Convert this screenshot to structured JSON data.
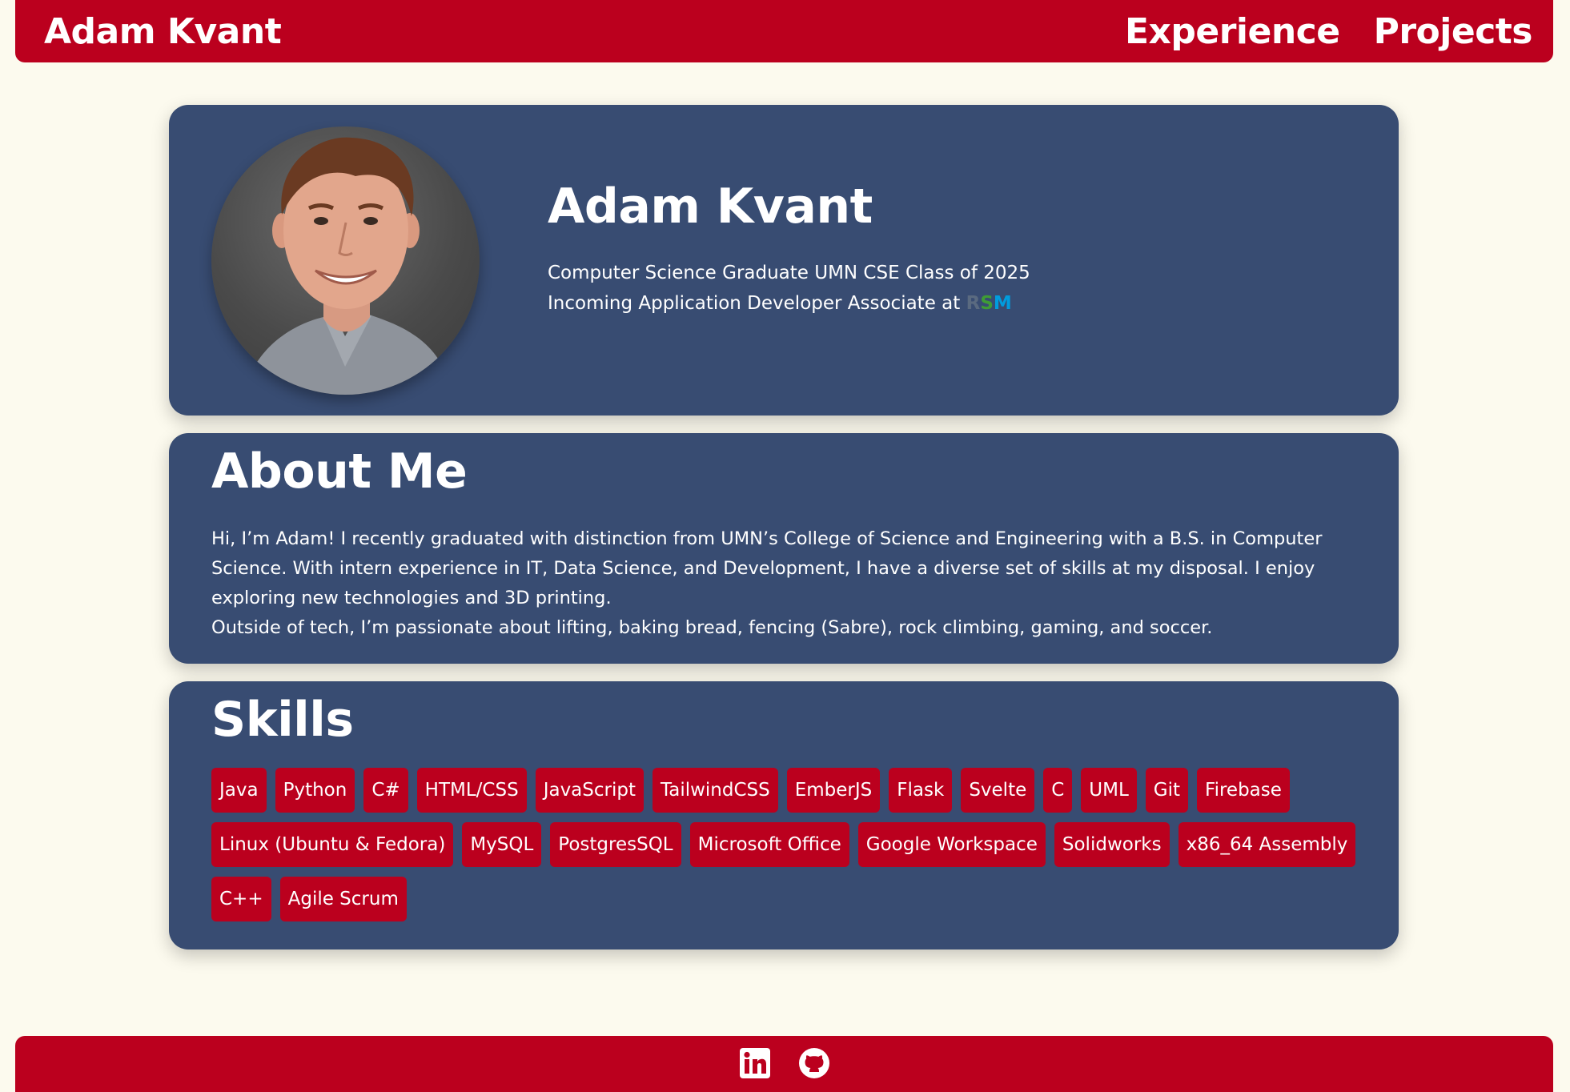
{
  "header": {
    "brand": "Adam Kvant",
    "nav": [
      {
        "label": "Experience"
      },
      {
        "label": "Projects"
      }
    ]
  },
  "hero": {
    "name": "Adam Kvant",
    "line1": "Computer Science Graduate UMN CSE Class of 2025",
    "line2_prefix": "Incoming Application Developer Associate at ",
    "company_logo": {
      "r": "R",
      "s": "S",
      "m": "M"
    }
  },
  "about": {
    "title": "About Me",
    "paragraph1": "Hi, I’m Adam! I recently graduated with distinction from UMN’s College of Science and Engineering with a B.S. in Computer Science. With intern experience in IT, Data Science, and Development, I have a diverse set of skills at my disposal. I enjoy exploring new technologies and 3D printing.",
    "paragraph2": "Outside of tech, I’m passionate about lifting, baking bread, fencing (Sabre), rock climbing, gaming, and soccer."
  },
  "skills": {
    "title": "Skills",
    "tags": [
      "Java",
      "Python",
      "C#",
      "HTML/CSS",
      "JavaScript",
      "TailwindCSS",
      "EmberJS",
      "Flask",
      "Svelte",
      "C",
      "UML",
      "Git",
      "Firebase",
      "Linux (Ubuntu & Fedora)",
      "MySQL",
      "PostgresSQL",
      "Microsoft Office",
      "Google Workspace",
      "Solidworks",
      "x86_64 Assembly",
      "C++",
      "Agile Scrum"
    ]
  },
  "footer": {
    "icons": [
      "linkedin-icon",
      "github-icon"
    ]
  },
  "colors": {
    "primary_red": "#bb001e",
    "card_blue": "#384c72",
    "background": "#fcfaee"
  }
}
